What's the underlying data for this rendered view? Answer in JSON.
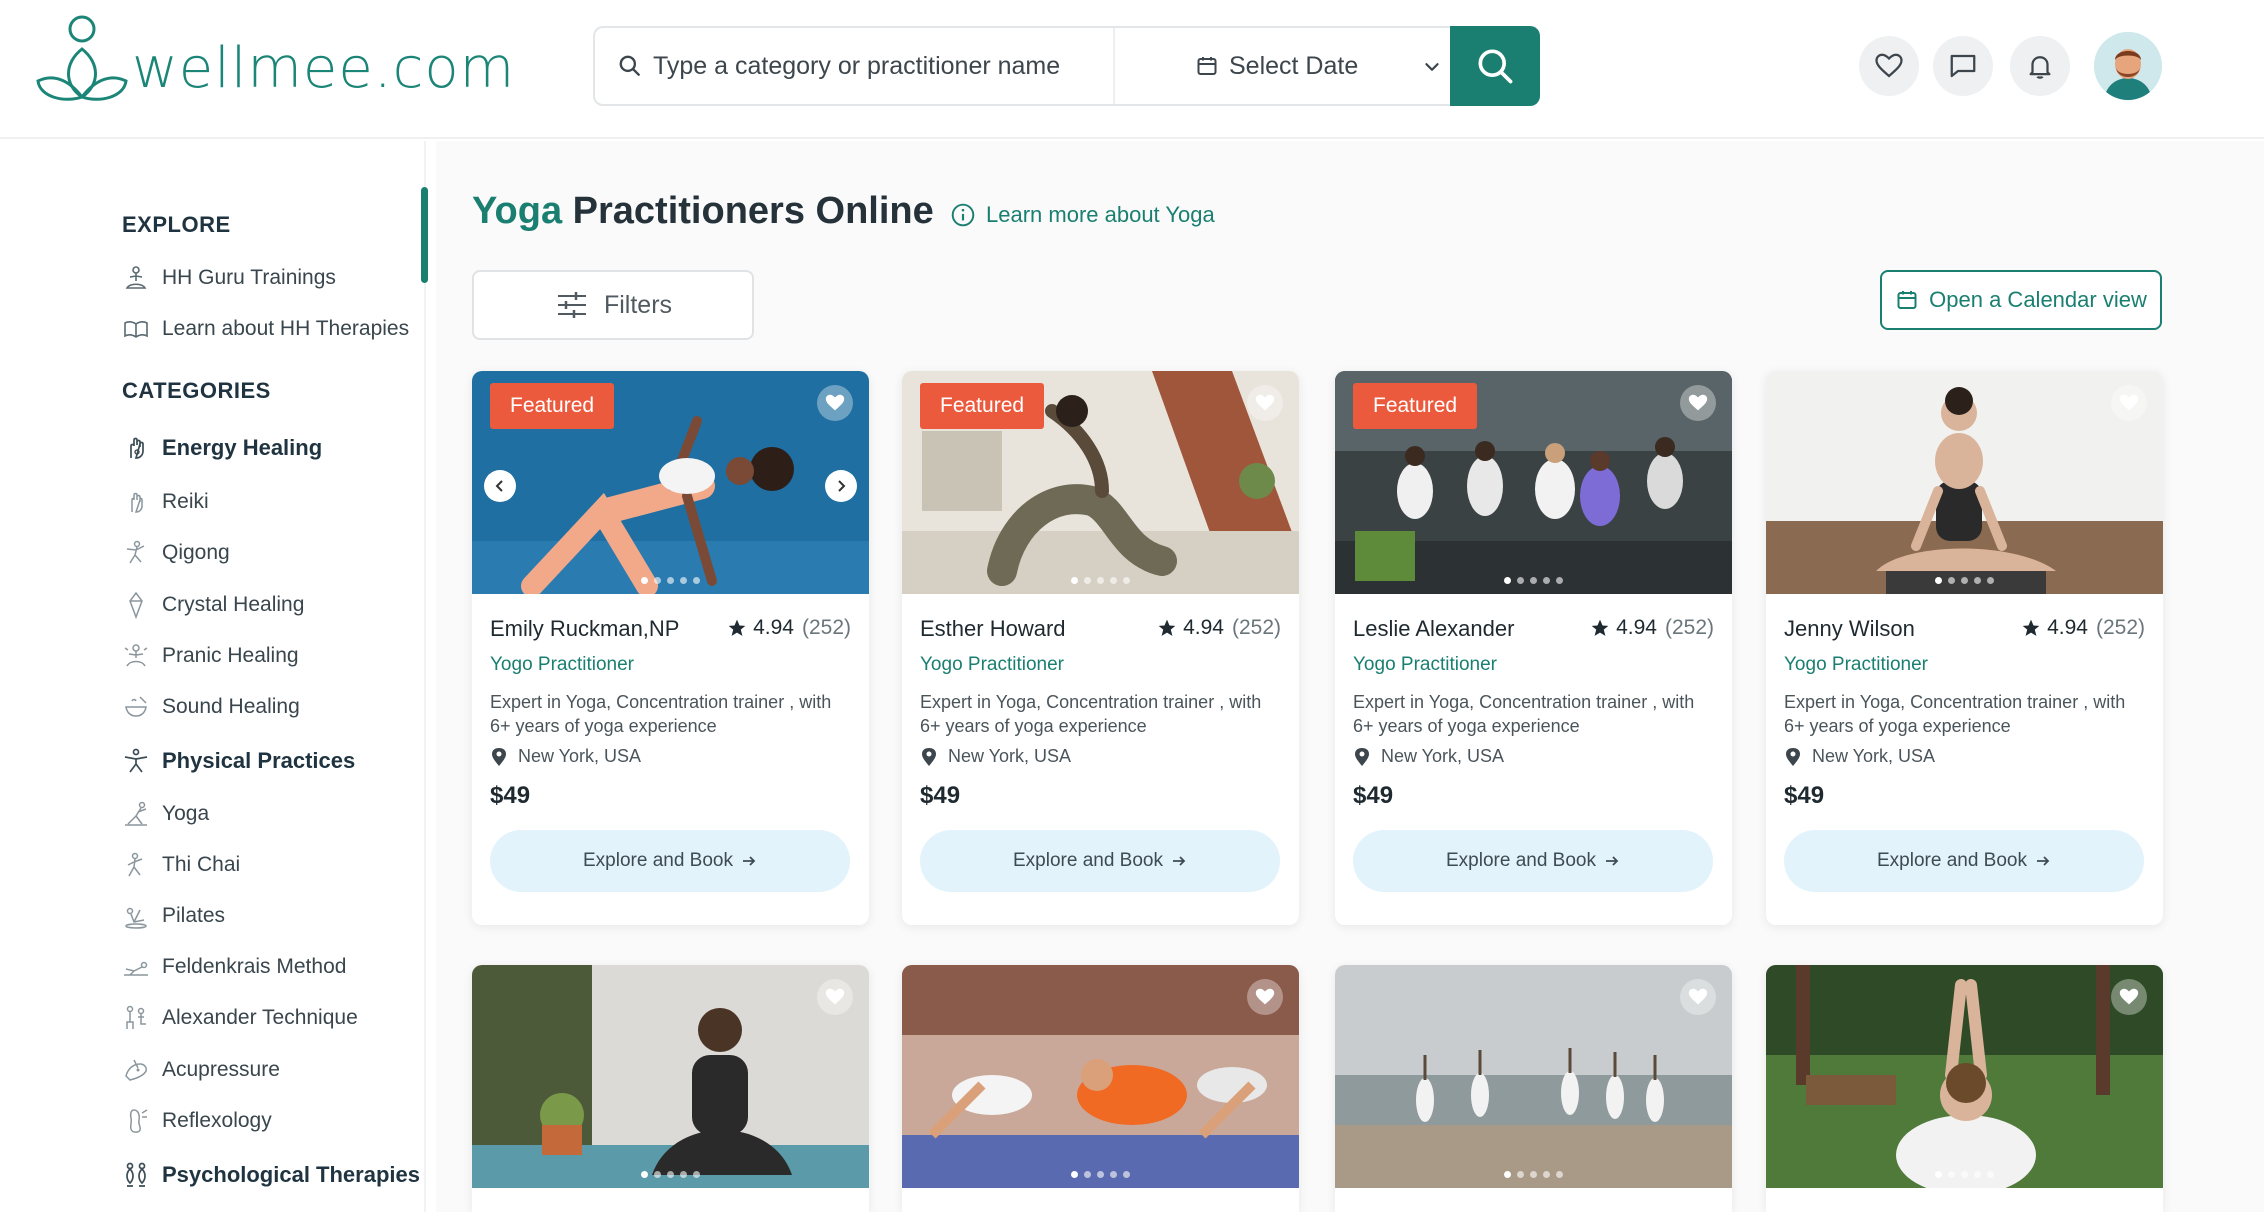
{
  "header": {
    "logo_text": "wellmee.com",
    "search_placeholder": "Type a category or practitioner name",
    "date_label": "Select Date"
  },
  "sidebar": {
    "explore_heading": "EXPLORE",
    "explore_items": [
      {
        "label": "HH Guru Trainings",
        "icon": "meditation-icon"
      },
      {
        "label": "Learn about HH Therapies",
        "icon": "open-book-icon"
      }
    ],
    "categories_heading": "CATEGORIES",
    "categories": [
      {
        "label": "Energy Healing",
        "icon": "hand-energy-icon",
        "bold": true
      },
      {
        "label": "Reiki",
        "icon": "reiki-hand-icon",
        "bold": false
      },
      {
        "label": "Qigong",
        "icon": "qigong-icon",
        "bold": false
      },
      {
        "label": "Crystal Healing",
        "icon": "crystal-icon",
        "bold": false
      },
      {
        "label": "Pranic Healing",
        "icon": "pranic-icon",
        "bold": false
      },
      {
        "label": "Sound Healing",
        "icon": "sound-bowl-icon",
        "bold": false
      },
      {
        "label": "Physical Practices",
        "icon": "physical-figure-icon",
        "bold": true
      },
      {
        "label": "Yoga",
        "icon": "yoga-pose-icon",
        "bold": false
      },
      {
        "label": "Thi Chai",
        "icon": "tai-chi-icon",
        "bold": false
      },
      {
        "label": "Pilates",
        "icon": "pilates-icon",
        "bold": false
      },
      {
        "label": "Feldenkrais Method",
        "icon": "feldenkrais-icon",
        "bold": false
      },
      {
        "label": "Alexander Technique",
        "icon": "alexander-icon",
        "bold": false
      },
      {
        "label": "Acupressure",
        "icon": "acupressure-icon",
        "bold": false
      },
      {
        "label": "Reflexology",
        "icon": "reflexology-icon",
        "bold": false
      },
      {
        "label": "Psychological Therapies",
        "icon": "psychology-icon",
        "bold": true
      }
    ]
  },
  "main": {
    "title_accent": "Yoga",
    "title_rest": " Practitioners Online",
    "learn_more": "Learn more about Yoga",
    "filters_label": "Filters",
    "calendar_label": "Open a Calendar view",
    "cards": [
      {
        "featured": "Featured",
        "name": "Emily Ruckman,NP",
        "rating": "4.94",
        "reviews": "(252)",
        "role": "Yogo Practitioner",
        "desc": "Expert in Yoga, Concentration trainer , with 6+ years of yoga experience",
        "location": "New York, USA",
        "price": "$49",
        "cta": "Explore and Book"
      },
      {
        "featured": "Featured",
        "name": "Esther Howard",
        "rating": "4.94",
        "reviews": "(252)",
        "role": "Yogo Practitioner",
        "desc": "Expert in Yoga, Concentration trainer , with 6+ years of yoga experience",
        "location": "New York, USA",
        "price": "$49",
        "cta": "Explore and Book"
      },
      {
        "featured": "Featured",
        "name": "Leslie Alexander",
        "rating": "4.94",
        "reviews": "(252)",
        "role": "Yogo Practitioner",
        "desc": "Expert in Yoga, Concentration trainer , with 6+ years of yoga experience",
        "location": "New York, USA",
        "price": "$49",
        "cta": "Explore and Book"
      },
      {
        "featured": "",
        "name": "Jenny Wilson",
        "rating": "4.94",
        "reviews": "(252)",
        "role": "Yogo Practitioner",
        "desc": "Expert in Yoga, Concentration trainer , with 6+ years of yoga experience",
        "location": "New York, USA",
        "price": "$49",
        "cta": "Explore and Book"
      }
    ]
  },
  "colors": {
    "brand": "#1a7f71",
    "featured": "#ec5a3e",
    "book_bg": "#e2f3fb"
  }
}
